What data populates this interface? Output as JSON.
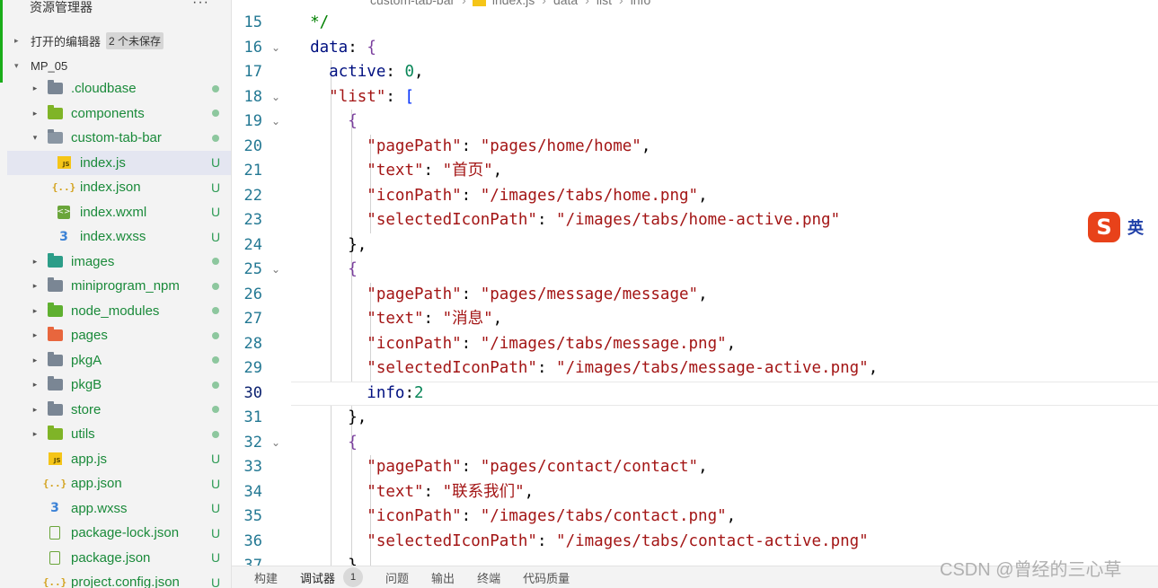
{
  "sidebar": {
    "title": "资源管理器",
    "more": "···",
    "open_editors": {
      "label": "打开的编辑器",
      "badge": "2 个未保存"
    },
    "project": {
      "label": "MP_05"
    },
    "items": [
      {
        "name": ".cloudbase",
        "type": "folder",
        "color": "grey",
        "status": "dot",
        "indent": 0,
        "twisty": "▸"
      },
      {
        "name": "components",
        "type": "folder",
        "color": "lime",
        "status": "dot",
        "indent": 0,
        "twisty": "▸"
      },
      {
        "name": "custom-tab-bar",
        "type": "folder-open",
        "color": "grey",
        "status": "dot",
        "indent": 0,
        "twisty": "▾"
      },
      {
        "name": "index.js",
        "type": "js",
        "status": "U",
        "indent": 1,
        "selected": true
      },
      {
        "name": "index.json",
        "type": "json",
        "status": "U",
        "indent": 1
      },
      {
        "name": "index.wxml",
        "type": "wxml",
        "status": "U",
        "indent": 1
      },
      {
        "name": "index.wxss",
        "type": "wxss",
        "status": "U",
        "indent": 1
      },
      {
        "name": "images",
        "type": "folder",
        "color": "teal",
        "status": "dot",
        "indent": 0,
        "twisty": "▸"
      },
      {
        "name": "miniprogram_npm",
        "type": "folder",
        "color": "grey",
        "status": "dot",
        "indent": 0,
        "twisty": "▸"
      },
      {
        "name": "node_modules",
        "type": "folder",
        "color": "green",
        "status": "dot",
        "indent": 0,
        "twisty": "▸"
      },
      {
        "name": "pages",
        "type": "folder",
        "color": "orange",
        "status": "dot",
        "indent": 0,
        "twisty": "▸"
      },
      {
        "name": "pkgA",
        "type": "folder",
        "color": "grey",
        "status": "dot",
        "indent": 0,
        "twisty": "▸"
      },
      {
        "name": "pkgB",
        "type": "folder",
        "color": "grey",
        "status": "dot",
        "indent": 0,
        "twisty": "▸"
      },
      {
        "name": "store",
        "type": "folder",
        "color": "grey",
        "status": "dot",
        "indent": 0,
        "twisty": "▸"
      },
      {
        "name": "utils",
        "type": "folder",
        "color": "lime",
        "status": "dot",
        "indent": 0,
        "twisty": "▸"
      },
      {
        "name": "app.js",
        "type": "js",
        "status": "U",
        "indent": 0
      },
      {
        "name": "app.json",
        "type": "json",
        "status": "U",
        "indent": 0
      },
      {
        "name": "app.wxss",
        "type": "wxss",
        "status": "U",
        "indent": 0
      },
      {
        "name": "package-lock.json",
        "type": "lock",
        "status": "U",
        "indent": 0
      },
      {
        "name": "package.json",
        "type": "lock",
        "status": "U",
        "indent": 0
      },
      {
        "name": "project.config.json",
        "type": "json",
        "status": "U",
        "indent": 0
      }
    ]
  },
  "breadcrumb": [
    "custom-tab-bar",
    "index.js",
    "data",
    "list",
    "info"
  ],
  "editor": {
    "current_line": 30,
    "lines": [
      {
        "n": 15,
        "fold": "",
        "text": "  */"
      },
      {
        "n": 16,
        "fold": "⌄",
        "text": "  data: {"
      },
      {
        "n": 17,
        "fold": "",
        "text": "    active: 0,"
      },
      {
        "n": 18,
        "fold": "⌄",
        "text": "    \"list\": ["
      },
      {
        "n": 19,
        "fold": "⌄",
        "text": "      {"
      },
      {
        "n": 20,
        "fold": "",
        "text": "        \"pagePath\": \"pages/home/home\","
      },
      {
        "n": 21,
        "fold": "",
        "text": "        \"text\": \"首页\","
      },
      {
        "n": 22,
        "fold": "",
        "text": "        \"iconPath\": \"/images/tabs/home.png\","
      },
      {
        "n": 23,
        "fold": "",
        "text": "        \"selectedIconPath\": \"/images/tabs/home-active.png\""
      },
      {
        "n": 24,
        "fold": "",
        "text": "      },"
      },
      {
        "n": 25,
        "fold": "⌄",
        "text": "      {"
      },
      {
        "n": 26,
        "fold": "",
        "text": "        \"pagePath\": \"pages/message/message\","
      },
      {
        "n": 27,
        "fold": "",
        "text": "        \"text\": \"消息\","
      },
      {
        "n": 28,
        "fold": "",
        "text": "        \"iconPath\": \"/images/tabs/message.png\","
      },
      {
        "n": 29,
        "fold": "",
        "text": "        \"selectedIconPath\": \"/images/tabs/message-active.png\","
      },
      {
        "n": 30,
        "fold": "",
        "text": "        info:2"
      },
      {
        "n": 31,
        "fold": "",
        "text": "      },"
      },
      {
        "n": 32,
        "fold": "⌄",
        "text": "      {"
      },
      {
        "n": 33,
        "fold": "",
        "text": "        \"pagePath\": \"pages/contact/contact\","
      },
      {
        "n": 34,
        "fold": "",
        "text": "        \"text\": \"联系我们\","
      },
      {
        "n": 35,
        "fold": "",
        "text": "        \"iconPath\": \"/images/tabs/contact.png\","
      },
      {
        "n": 36,
        "fold": "",
        "text": "        \"selectedIconPath\": \"/images/tabs/contact-active.png\""
      },
      {
        "n": 37,
        "fold": "",
        "text": "      }"
      }
    ]
  },
  "ime": {
    "logo": "S",
    "lang": "英"
  },
  "bottom_panel": {
    "tabs": [
      {
        "label": "构建"
      },
      {
        "label": "调试器",
        "count": "1",
        "active": true
      },
      {
        "label": "问题"
      },
      {
        "label": "输出"
      },
      {
        "label": "终端"
      },
      {
        "label": "代码质量"
      }
    ]
  },
  "watermark": "CSDN @曾经的三心草",
  "colors": {
    "accent": "#1aad19",
    "line_number": "#237893",
    "string": "#a31515",
    "tree_name": "#1a8a3a"
  }
}
